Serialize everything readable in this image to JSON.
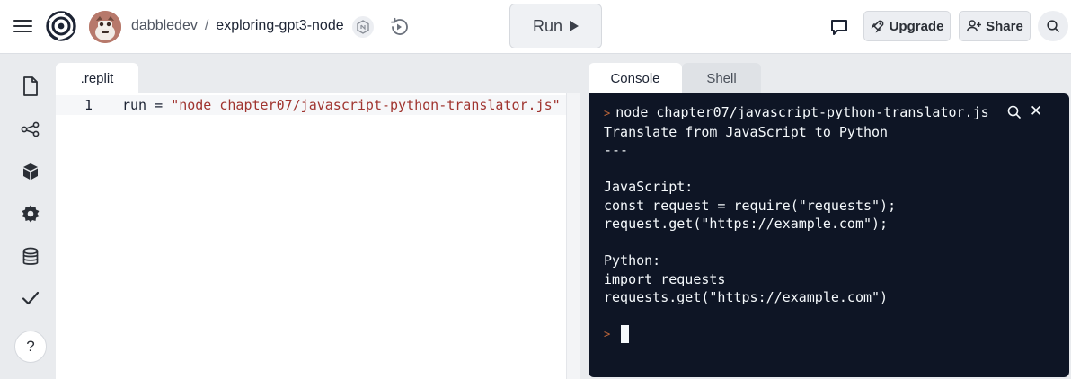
{
  "header": {
    "owner": "dabbledev",
    "separator": "/",
    "repl_name": "exploring-gpt3-node",
    "run_label": "Run",
    "upgrade_label": "Upgrade",
    "share_label": "Share"
  },
  "editor": {
    "tab_label": ".replit",
    "lines": [
      {
        "number": "1",
        "key": "run",
        "operator": " = ",
        "value": "\"node chapter07/javascript-python-translator.js\""
      }
    ]
  },
  "console": {
    "tabs": [
      {
        "label": "Console",
        "active": true
      },
      {
        "label": "Shell",
        "active": false
      }
    ],
    "command": "node chapter07/javascript-python-translator.js",
    "output_lines": [
      "Translate from JavaScript to Python",
      "---",
      "",
      "JavaScript:",
      "const request = require(\"requests\");",
      "request.get(\"https://example.com\");",
      "",
      "Python:",
      "import requests",
      "requests.get(\"https://example.com\")"
    ]
  },
  "colors": {
    "console_bg": "#0e1525",
    "prompt_accent": "#c2683a",
    "string_token": "#a0342f",
    "avatar_bg": "#b7796b"
  },
  "icons": {
    "sidebar": [
      "file-icon",
      "git-branch-icon",
      "package-icon",
      "gear-icon",
      "database-icon",
      "checkmark-icon"
    ],
    "header": [
      "hamburger-menu-icon",
      "replit-logo-icon",
      "nodejs-icon",
      "history-icon",
      "chat-icon",
      "rocket-icon",
      "add-user-icon",
      "search-icon"
    ]
  }
}
